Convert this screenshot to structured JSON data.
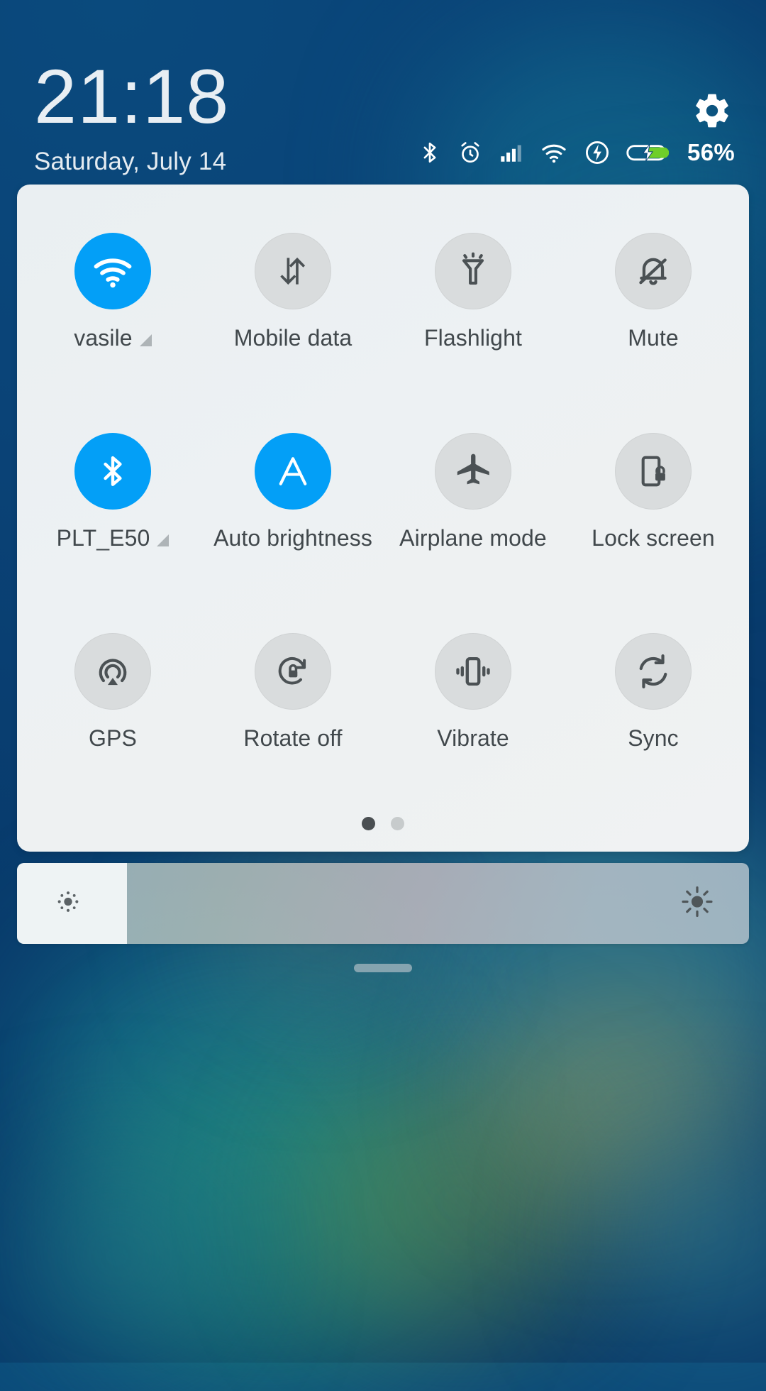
{
  "status": {
    "time": "21:18",
    "date": "Saturday, July 14",
    "battery_percent": "56%",
    "icons": [
      {
        "name": "bluetooth-icon"
      },
      {
        "name": "alarm-icon"
      },
      {
        "name": "cellular-signal-icon"
      },
      {
        "name": "wifi-icon"
      },
      {
        "name": "fast-charging-icon"
      },
      {
        "name": "battery-charging-icon"
      }
    ],
    "settings_label": "Settings",
    "colors": {
      "battery_fill": "#6fce2a",
      "status_text": "#ffffff"
    }
  },
  "quick_settings": {
    "tiles": [
      {
        "label": "vasile",
        "icon": "wifi-icon",
        "active": true,
        "expandable": true
      },
      {
        "label": "Mobile data",
        "icon": "mobile-data-icon",
        "active": false,
        "expandable": false
      },
      {
        "label": "Flashlight",
        "icon": "flashlight-icon",
        "active": false,
        "expandable": false
      },
      {
        "label": "Mute",
        "icon": "bell-muted-icon",
        "active": false,
        "expandable": false
      },
      {
        "label": "PLT_E50",
        "icon": "bluetooth-icon",
        "active": true,
        "expandable": true
      },
      {
        "label": "Auto brightness",
        "icon": "auto-brightness-icon",
        "active": true,
        "expandable": false
      },
      {
        "label": "Airplane mode",
        "icon": "airplane-icon",
        "active": false,
        "expandable": false
      },
      {
        "label": "Lock screen",
        "icon": "lock-screen-icon",
        "active": false,
        "expandable": false
      },
      {
        "label": "GPS",
        "icon": "gps-icon",
        "active": false,
        "expandable": false
      },
      {
        "label": "Rotate off",
        "icon": "rotate-lock-icon",
        "active": false,
        "expandable": false
      },
      {
        "label": "Vibrate",
        "icon": "vibrate-icon",
        "active": false,
        "expandable": false
      },
      {
        "label": "Sync",
        "icon": "sync-icon",
        "active": false,
        "expandable": false
      }
    ],
    "pages": 2,
    "current_page": 1,
    "active_color": "#039ff7",
    "inactive_color": "#d9dcdd"
  },
  "brightness": {
    "value_percent": 15,
    "low_icon": "brightness-low-icon",
    "high_icon": "brightness-high-icon"
  },
  "drag_handle": {
    "name": "panel-drag-handle"
  }
}
